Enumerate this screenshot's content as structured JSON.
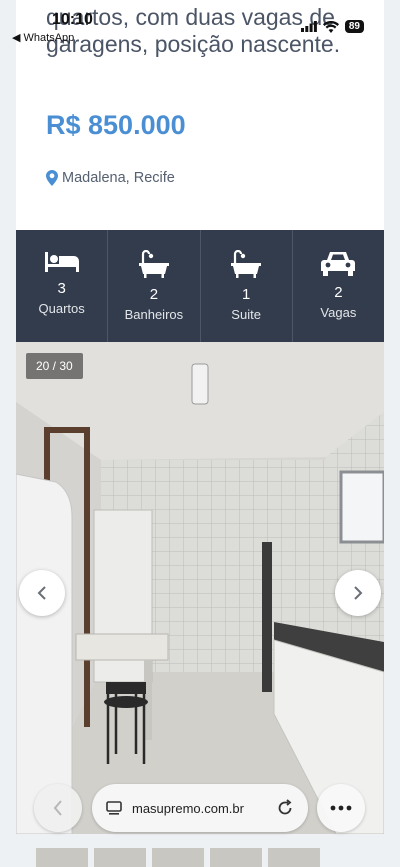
{
  "status_bar": {
    "time": "10:10",
    "back_app": "◀ WhatsApp",
    "battery": "89"
  },
  "listing": {
    "description": "quartos, com duas vagas de garagens, posição nascente.",
    "price": "R$ 850.000",
    "location": "Madalena, Recife",
    "accent_color": "#4a8fd3"
  },
  "features": [
    {
      "icon": "bed-icon",
      "count": "3",
      "label": "Quartos"
    },
    {
      "icon": "bathtub-icon",
      "count": "2",
      "label": "Banheiros"
    },
    {
      "icon": "bathtub-icon",
      "count": "1",
      "label": "Suite"
    },
    {
      "icon": "car-icon",
      "count": "2",
      "label": "Vagas"
    }
  ],
  "gallery": {
    "counter": "20 / 30"
  },
  "browser": {
    "url": "masupremo.com.br"
  }
}
